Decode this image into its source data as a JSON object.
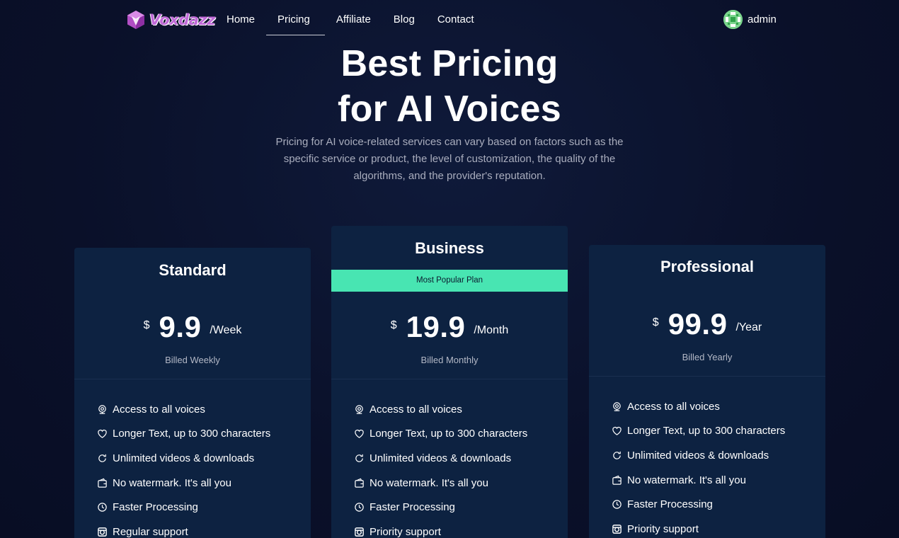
{
  "brand": {
    "name": "Voxdazz",
    "icon": "hexagon-logo-icon"
  },
  "nav": {
    "links": [
      {
        "label": "Home"
      },
      {
        "label": "Pricing",
        "active": true
      },
      {
        "label": "Affiliate"
      },
      {
        "label": "Blog"
      },
      {
        "label": "Contact"
      }
    ]
  },
  "user": {
    "name": "admin",
    "avatar_color": "#7bd58d"
  },
  "hero": {
    "title_line1": "Best Pricing",
    "title_line2": "for AI Voices",
    "description": "Pricing for AI voice-related services can vary based on factors such as the specific service or product, the level of customization, the quality of the algorithms, and the provider's reputation."
  },
  "colors": {
    "accent": "#48e5b2",
    "card_bg": "#0d2241",
    "page_bg": "#0b1230",
    "brand": "#c06ad8"
  },
  "plans": [
    {
      "name": "Standard",
      "currency": "$",
      "amount": "9.9",
      "period": "/Week",
      "billed": "Billed Weekly",
      "features": [
        {
          "icon": "webcam-icon",
          "label": "Access to all voices"
        },
        {
          "icon": "heart-icon",
          "label": "Longer Text, up to 300 characters"
        },
        {
          "icon": "refresh-icon",
          "label": "Unlimited videos & downloads"
        },
        {
          "icon": "wallet-icon",
          "label": "No watermark. It's all you"
        },
        {
          "icon": "clock-icon",
          "label": "Faster Processing"
        },
        {
          "icon": "instagram-icon",
          "label": "Regular support"
        }
      ]
    },
    {
      "name": "Business",
      "badge": "Most Popular Plan",
      "currency": "$",
      "amount": "19.9",
      "period": "/Month",
      "billed": "Billed Monthly",
      "features": [
        {
          "icon": "webcam-icon",
          "label": "Access to all voices"
        },
        {
          "icon": "heart-icon",
          "label": "Longer Text, up to 300 characters"
        },
        {
          "icon": "refresh-icon",
          "label": "Unlimited videos & downloads"
        },
        {
          "icon": "wallet-icon",
          "label": "No watermark. It's all you"
        },
        {
          "icon": "clock-icon",
          "label": "Faster Processing"
        },
        {
          "icon": "instagram-icon",
          "label": "Priority support"
        }
      ]
    },
    {
      "name": "Professional",
      "currency": "$",
      "amount": "99.9",
      "period": "/Year",
      "billed": "Billed Yearly",
      "features": [
        {
          "icon": "webcam-icon",
          "label": "Access to all voices"
        },
        {
          "icon": "heart-icon",
          "label": "Longer Text, up to 300 characters"
        },
        {
          "icon": "refresh-icon",
          "label": "Unlimited videos & downloads"
        },
        {
          "icon": "wallet-icon",
          "label": "No watermark. It's all you"
        },
        {
          "icon": "clock-icon",
          "label": "Faster Processing"
        },
        {
          "icon": "instagram-icon",
          "label": "Priority support"
        }
      ]
    }
  ]
}
